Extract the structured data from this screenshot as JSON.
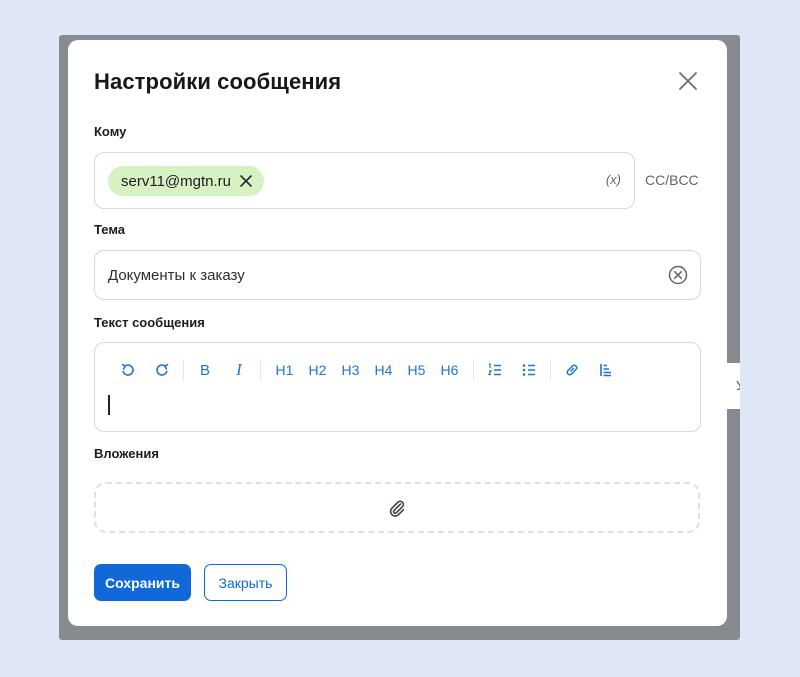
{
  "dialog": {
    "title": "Настройки сообщения"
  },
  "to": {
    "label": "Кому",
    "recipients": [
      {
        "email": "serv11@mgtn.ru"
      }
    ],
    "variables_label": "(x)",
    "cc_bcc_label": "CC/BCC"
  },
  "subject": {
    "label": "Тема",
    "value": "Документы к заказу"
  },
  "message": {
    "label": "Текст сообщения",
    "toolbar": {
      "bold": "B",
      "italic": "I",
      "headings": [
        "H1",
        "H2",
        "H3",
        "H4",
        "H5",
        "H6"
      ]
    }
  },
  "attachments": {
    "label": "Вложения"
  },
  "side_tip": {
    "text": "У"
  },
  "actions": {
    "save_label": "Сохранить",
    "close_label": "Закрыть"
  },
  "colors": {
    "accent": "#1168d8",
    "toolbar_icon": "#1f73d8",
    "chip_bg": "#d7f2c2",
    "page_bg": "#dfe6f6",
    "overlay": "#878a8f"
  }
}
